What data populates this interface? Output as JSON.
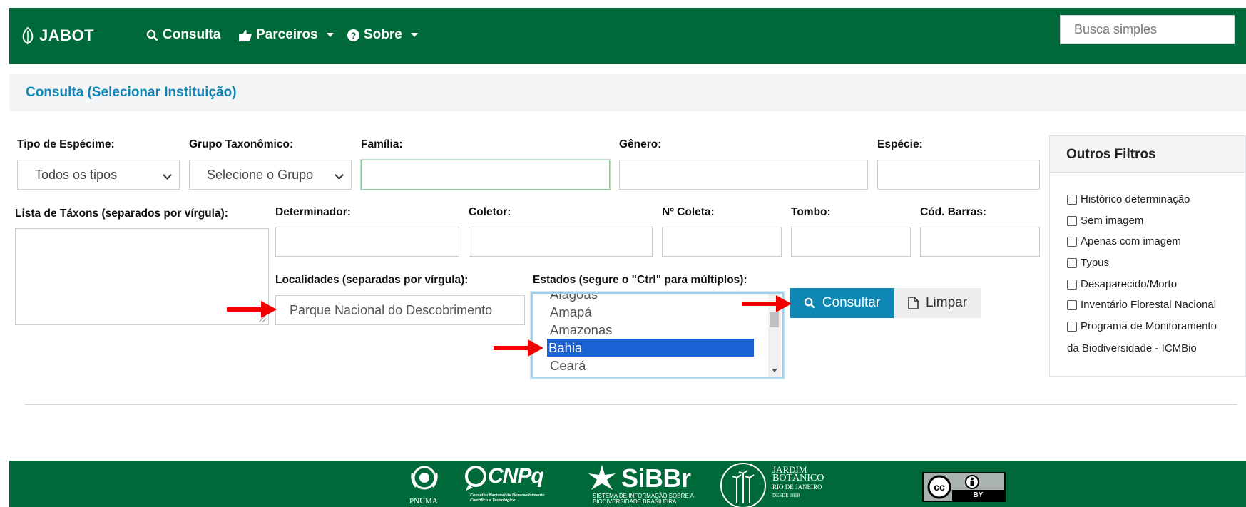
{
  "navbar": {
    "brand": "JABOT",
    "items": [
      {
        "label": "Consulta",
        "icon": "search-icon"
      },
      {
        "label": "Parceiros",
        "icon": "thumbs-up-icon"
      },
      {
        "label": "Sobre",
        "icon": "question-circle-icon"
      }
    ],
    "search_placeholder": "Busca simples"
  },
  "breadcrumb": {
    "title": "Consulta (Selecionar Instituição)"
  },
  "form": {
    "tipo_label": "Tipo de Espécime:",
    "tipo_value": "Todos os tipos",
    "grupo_label": "Grupo Taxonômico:",
    "grupo_value": "Selecione o Grupo",
    "familia_label": "Família:",
    "genero_label": "Gênero:",
    "especie_label": "Espécie:",
    "taxons_label": "Lista de Táxons (separados por vírgula):",
    "determinador_label": "Determinador:",
    "coletor_label": "Coletor:",
    "ncoleta_label": "Nº Coleta:",
    "tombo_label": "Tombo:",
    "codbarras_label": "Cód. Barras:",
    "localidades_label": "Localidades (separadas por vírgula):",
    "localidades_value": "Parque Nacional do Descobrimento",
    "estados_label": "Estados (segure o \"Ctrl\" para múltiplos):",
    "estados_options": [
      "Alagoas",
      "Amapá",
      "Amazonas",
      "Bahia",
      "Ceará"
    ],
    "estados_selected": "Bahia"
  },
  "buttons": {
    "consultar": "Consultar",
    "limpar": "Limpar"
  },
  "outros_filtros": {
    "title": "Outros Filtros",
    "items": [
      "Histórico determinação",
      "Sem imagem",
      "Apenas com imagem",
      "Typus",
      "Desaparecido/Morto",
      "Inventário Florestal Nacional",
      "Programa de Monitoramento"
    ],
    "last_item_continuation": "da Biodiversidade - ICMBio"
  },
  "footer": {
    "logos": [
      "PNUMA",
      "CNPq",
      "SiBBr",
      "JARDIM BOTÂNICO RIO DE JANEIRO"
    ],
    "cnpq_sub": "Conselho Nacional de Desenvolvimento Científico e Tecnológico",
    "sibbr_sub": "SISTEMA DE INFORMAÇÃO SOBRE A BIODIVERSIDADE BRASILEIRA",
    "jbrj_lines": [
      "JARDIM",
      "BOTÂNICO",
      "RIO DE JANEIRO",
      "DESDE 1808"
    ],
    "cc_text": "BY"
  }
}
